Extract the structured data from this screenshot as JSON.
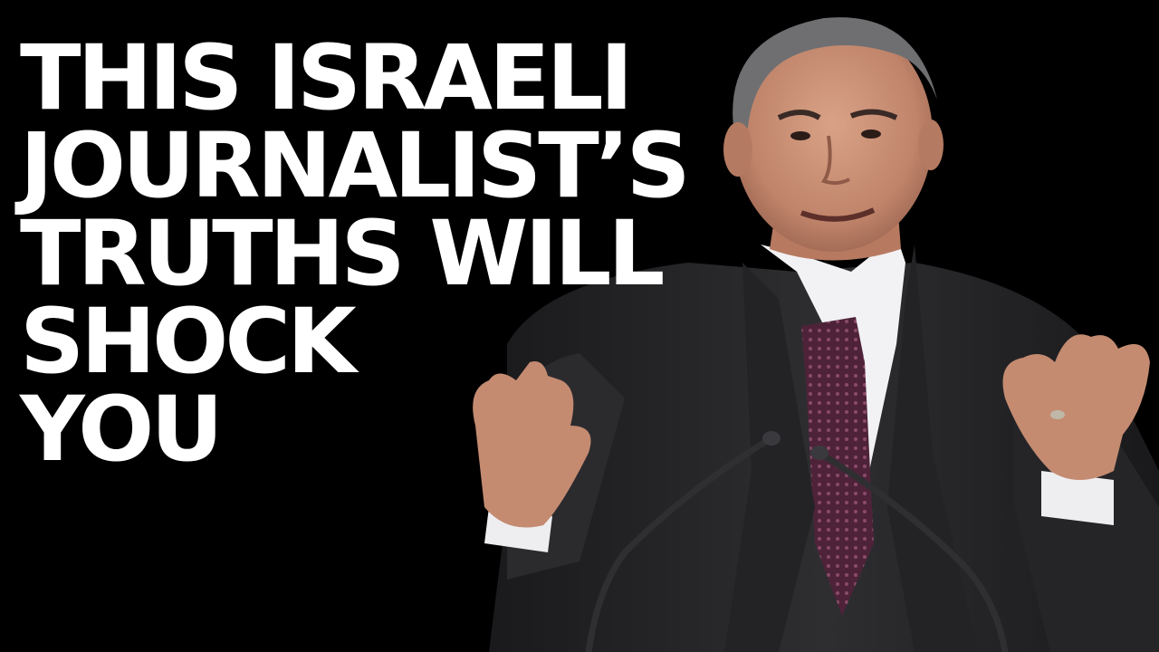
{
  "thumbnail": {
    "headline": [
      "THIS ISRAELI",
      "JOURNALIST’S",
      "TRUTHS WILL",
      "SHOCK",
      "YOU"
    ],
    "colors": {
      "background": "#000000",
      "headline_text": "#ffffff",
      "suit": "#2a2a2c",
      "shirt": "#f2f2f4",
      "tie": "#5a2a44",
      "skin": "#c98f74",
      "hair": "#6f6f72"
    },
    "scene": {
      "subject": "speaker at podium with raised hands",
      "microphones": 2
    }
  }
}
